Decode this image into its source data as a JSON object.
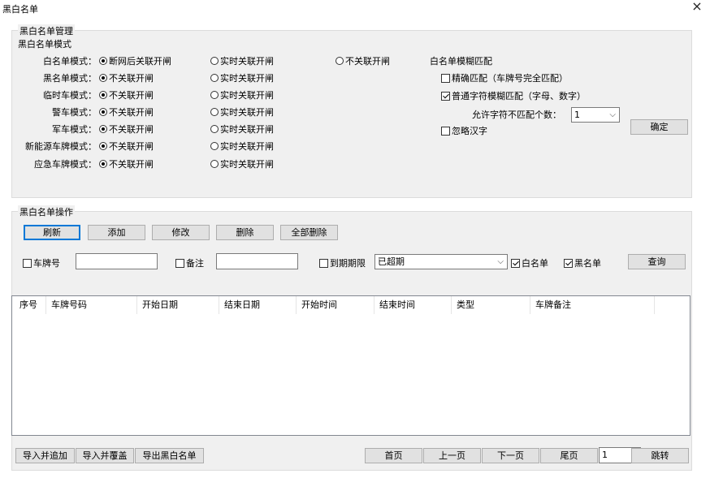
{
  "window": {
    "title": "黑白名单",
    "close_glyph": "×"
  },
  "mode_group": {
    "legend": "黑白名单管理",
    "subtitle": "黑白名单模式",
    "rows": [
      {
        "label": "白名单模式：",
        "options": [
          "断网后关联开闸",
          "实时关联开闸",
          "不关联开闸"
        ],
        "selected": 0
      },
      {
        "label": "黑名单模式：",
        "options": [
          "不关联开闸",
          "实时关联开闸"
        ],
        "selected": 0
      },
      {
        "label": "临时车模式：",
        "options": [
          "不关联开闸",
          "实时关联开闸"
        ],
        "selected": 0
      },
      {
        "label": "警车模式：",
        "options": [
          "不关联开闸",
          "实时关联开闸"
        ],
        "selected": 0
      },
      {
        "label": "军车模式：",
        "options": [
          "不关联开闸",
          "实时关联开闸"
        ],
        "selected": 0
      },
      {
        "label": "新能源车牌模式：",
        "options": [
          "不关联开闸",
          "实时关联开闸"
        ],
        "selected": 0
      },
      {
        "label": "应急车牌模式：",
        "options": [
          "不关联开闸",
          "实时关联开闸"
        ],
        "selected": 0
      }
    ],
    "fuzzy": {
      "title": "白名单模糊匹配",
      "exact": {
        "label": "精确匹配（车牌号完全匹配）",
        "checked": false
      },
      "normal": {
        "label": "普通字符模糊匹配（字母、数字）",
        "checked": true
      },
      "mismatch_label": "允许字符不匹配个数：",
      "mismatch_value": "1",
      "ignore_cn": {
        "label": "忽略汉字",
        "checked": false
      },
      "confirm_label": "确定"
    }
  },
  "ops_group": {
    "legend": "黑白名单操作",
    "buttons": [
      "刷新",
      "添加",
      "修改",
      "删除",
      "全部删除"
    ],
    "filters": {
      "plate_label": "车牌号",
      "plate_checked": false,
      "plate_value": "",
      "note_label": "备注",
      "note_checked": false,
      "note_value": "",
      "expire_label": "到期期限",
      "expire_checked": false,
      "expire_value": "已超期",
      "white_label": "白名单",
      "white_checked": true,
      "black_label": "黑名单",
      "black_checked": true,
      "query_label": "查询"
    },
    "table": {
      "columns": [
        "序号",
        "车牌号码",
        "开始日期",
        "结束日期",
        "开始时间",
        "结束时间",
        "类型",
        "车牌备注"
      ],
      "rows": []
    },
    "bottom": {
      "import_append": "导入并追加",
      "import_overwrite": "导入并覆盖",
      "export": "导出黑白名单",
      "first": "首页",
      "prev": "上一页",
      "next": "下一页",
      "last": "尾页",
      "page_value": "1",
      "jump": "跳转"
    }
  }
}
